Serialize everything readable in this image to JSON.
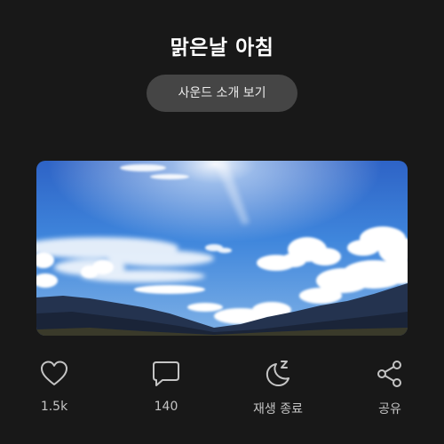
{
  "header": {
    "title": "맑은날 아침"
  },
  "sound_intro_button": {
    "label": "사운드 소개 보기"
  },
  "hero_image": {
    "description_icon": "sky-with-clouds-and-mountains-photo"
  },
  "actions": {
    "like": {
      "icon": "heart-icon",
      "count": "1.5k"
    },
    "comment": {
      "icon": "comment-icon",
      "count": "140"
    },
    "sleep_timer": {
      "icon": "moon-zzz-icon",
      "label": "재생 종료"
    },
    "share": {
      "icon": "share-icon",
      "label": "공유"
    }
  },
  "colors": {
    "background": "#181818",
    "button_bg": "#454545",
    "icon_stroke": "#c4c4c4",
    "title_text": "#ffffff"
  }
}
